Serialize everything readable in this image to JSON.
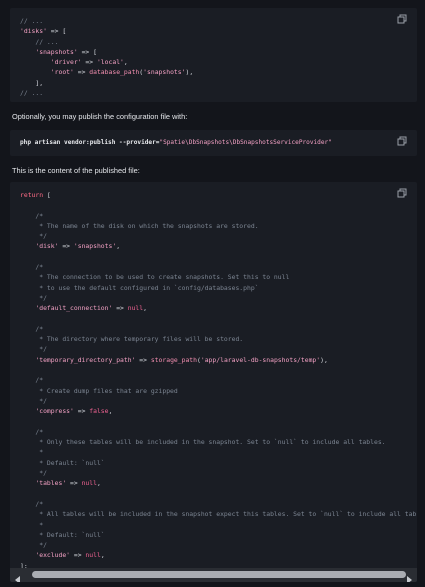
{
  "block1": {
    "lines": [
      "// ...",
      "'disks' => [",
      "    // ...",
      "    'snapshots' => [",
      "        'driver' => 'local',",
      "        'root' => database_path('snapshots'),",
      "    ],",
      "// ..."
    ]
  },
  "text1": "Optionally, you may publish the configuration file with:",
  "block2": {
    "command": "php artisan vendor:publish --provider=\"Spatie\\DbSnapshots\\DbSnapshotsServiceProvider\""
  },
  "text2": "This is the content of the published file:",
  "block3": {
    "lines": [
      "return [",
      "",
      "    /*",
      "     * The name of the disk on which the snapshots are stored.",
      "     */",
      "    'disk' => 'snapshots',",
      "",
      "    /*",
      "     * The connection to be used to create snapshots. Set this to null",
      "     * to use the default configured in `config/databases.php`",
      "     */",
      "    'default_connection' => null,",
      "",
      "    /*",
      "     * The directory where temporary files will be stored.",
      "     */",
      "    'temporary_directory_path' => storage_path('app/laravel-db-snapshots/temp'),",
      "",
      "    /*",
      "     * Create dump files that are gzipped",
      "     */",
      "    'compress' => false,",
      "",
      "    /*",
      "     * Only these tables will be included in the snapshot. Set to `null` to include all tables.",
      "     *",
      "     * Default: `null`",
      "     */",
      "    'tables' => null,",
      "",
      "    /*",
      "     * All tables will be included in the snapshot expect this tables. Set to `null` to include all tab",
      "     *",
      "     * Default: `null`",
      "     */",
      "    'exclude' => null,",
      "];"
    ]
  },
  "icons": {
    "copy": "copy-icon",
    "scroll_left": "arrow-left-icon",
    "scroll_right": "arrow-right-icon"
  },
  "colors": {
    "background": "#13151b",
    "code_bg": "#1a1d24",
    "string": "#f3a1c4",
    "comment": "#7c8592",
    "keyword": "#ff6b86"
  }
}
